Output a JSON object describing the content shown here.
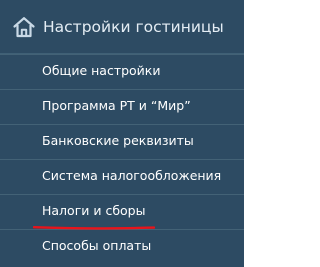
{
  "header": {
    "icon": "home-icon",
    "title": "Настройки гостиницы"
  },
  "items": [
    {
      "label": "Общие настройки"
    },
    {
      "label": "Программа РТ и “Мир”"
    },
    {
      "label": "Банковские реквизиты"
    },
    {
      "label": "Система налогообложения"
    },
    {
      "label": "Налоги и сборы",
      "highlighted": true
    },
    {
      "label": "Способы оплаты"
    }
  ],
  "colors": {
    "background": "#2d4b63",
    "text": "#ffffff",
    "header_text": "#e4edf4",
    "highlight": "#e8141b"
  }
}
